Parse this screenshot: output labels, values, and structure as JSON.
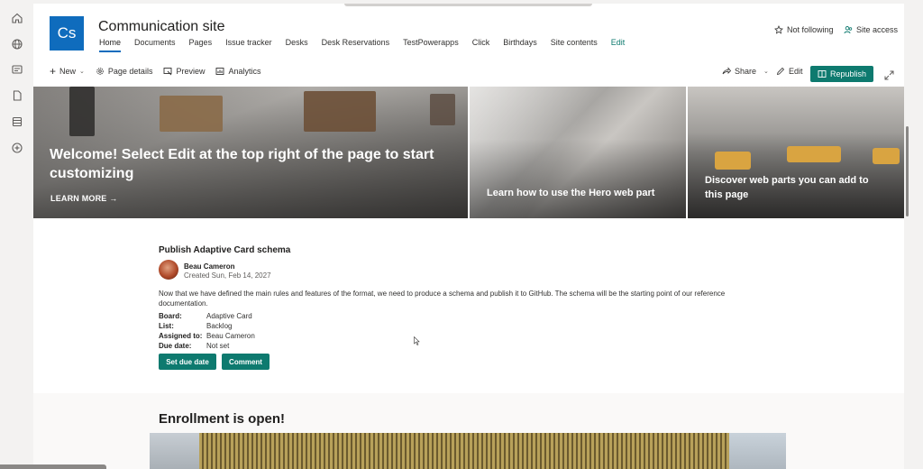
{
  "rail": {
    "icons": [
      "home-icon",
      "globe-icon",
      "news-icon",
      "document-icon",
      "list-icon",
      "add-icon"
    ]
  },
  "site": {
    "logo_text": "Cs",
    "title": "Communication site",
    "nav": [
      "Home",
      "Documents",
      "Pages",
      "Issue tracker",
      "Desks",
      "Desk Reservations",
      "TestPowerapps",
      "Click",
      "Birthdays",
      "Site contents",
      "Edit"
    ],
    "follow_label": "Not following",
    "site_access_label": "Site access"
  },
  "commandbar": {
    "new_label": "New",
    "page_details_label": "Page details",
    "preview_label": "Preview",
    "analytics_label": "Analytics",
    "share_label": "Share",
    "edit_label": "Edit",
    "republish_label": "Republish"
  },
  "hero": {
    "main_title": "Welcome! Select Edit at the top right of the page to start customizing",
    "learn_more": "LEARN MORE",
    "tile2_caption": "Learn how to use the Hero web part",
    "tile3_caption": "Discover web parts you can add to this page"
  },
  "task_card": {
    "title": "Publish Adaptive Card schema",
    "author": "Beau Cameron",
    "created": "Created Sun, Feb 14, 2027",
    "description": "Now that we have defined the main rules and features of the format, we need to produce a schema and publish it to GitHub. The schema will be the starting point of our reference documentation.",
    "fields": {
      "board_label": "Board:",
      "board_value": "Adaptive Card",
      "list_label": "List:",
      "list_value": "Backlog",
      "assigned_label": "Assigned to:",
      "assigned_value": "Beau Cameron",
      "due_label": "Due date:",
      "due_value": "Not set"
    },
    "set_due_date_label": "Set due date",
    "comment_label": "Comment"
  },
  "enrollment": {
    "title": "Enrollment is open!"
  },
  "colors": {
    "accent": "#0e7a6f",
    "site_logo": "#0f6cbd"
  }
}
